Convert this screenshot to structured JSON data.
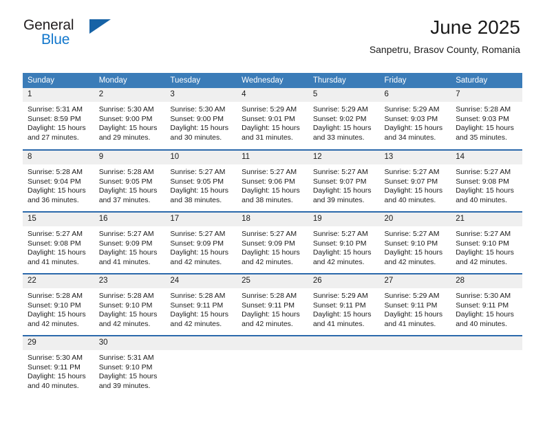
{
  "brand": {
    "name_part1": "General",
    "name_part2": "Blue",
    "triangle_icon": "triangle-icon",
    "colors": {
      "dark": "#231f20",
      "blue": "#1277cc",
      "triangle": "#1763a6"
    }
  },
  "header": {
    "title": "June 2025",
    "location": "Sanpetru, Brasov County, Romania"
  },
  "calendar": {
    "accent_color": "#3b7cb8",
    "row_divider_color": "#2a68ab",
    "daynum_band_color": "#efefef",
    "weekday_headers": [
      "Sunday",
      "Monday",
      "Tuesday",
      "Wednesday",
      "Thursday",
      "Friday",
      "Saturday"
    ],
    "weeks": [
      [
        {
          "day": "1",
          "sunrise": "Sunrise: 5:31 AM",
          "sunset": "Sunset: 8:59 PM",
          "daylight1": "Daylight: 15 hours",
          "daylight2": "and 27 minutes."
        },
        {
          "day": "2",
          "sunrise": "Sunrise: 5:30 AM",
          "sunset": "Sunset: 9:00 PM",
          "daylight1": "Daylight: 15 hours",
          "daylight2": "and 29 minutes."
        },
        {
          "day": "3",
          "sunrise": "Sunrise: 5:30 AM",
          "sunset": "Sunset: 9:00 PM",
          "daylight1": "Daylight: 15 hours",
          "daylight2": "and 30 minutes."
        },
        {
          "day": "4",
          "sunrise": "Sunrise: 5:29 AM",
          "sunset": "Sunset: 9:01 PM",
          "daylight1": "Daylight: 15 hours",
          "daylight2": "and 31 minutes."
        },
        {
          "day": "5",
          "sunrise": "Sunrise: 5:29 AM",
          "sunset": "Sunset: 9:02 PM",
          "daylight1": "Daylight: 15 hours",
          "daylight2": "and 33 minutes."
        },
        {
          "day": "6",
          "sunrise": "Sunrise: 5:29 AM",
          "sunset": "Sunset: 9:03 PM",
          "daylight1": "Daylight: 15 hours",
          "daylight2": "and 34 minutes."
        },
        {
          "day": "7",
          "sunrise": "Sunrise: 5:28 AM",
          "sunset": "Sunset: 9:03 PM",
          "daylight1": "Daylight: 15 hours",
          "daylight2": "and 35 minutes."
        }
      ],
      [
        {
          "day": "8",
          "sunrise": "Sunrise: 5:28 AM",
          "sunset": "Sunset: 9:04 PM",
          "daylight1": "Daylight: 15 hours",
          "daylight2": "and 36 minutes."
        },
        {
          "day": "9",
          "sunrise": "Sunrise: 5:28 AM",
          "sunset": "Sunset: 9:05 PM",
          "daylight1": "Daylight: 15 hours",
          "daylight2": "and 37 minutes."
        },
        {
          "day": "10",
          "sunrise": "Sunrise: 5:27 AM",
          "sunset": "Sunset: 9:05 PM",
          "daylight1": "Daylight: 15 hours",
          "daylight2": "and 38 minutes."
        },
        {
          "day": "11",
          "sunrise": "Sunrise: 5:27 AM",
          "sunset": "Sunset: 9:06 PM",
          "daylight1": "Daylight: 15 hours",
          "daylight2": "and 38 minutes."
        },
        {
          "day": "12",
          "sunrise": "Sunrise: 5:27 AM",
          "sunset": "Sunset: 9:07 PM",
          "daylight1": "Daylight: 15 hours",
          "daylight2": "and 39 minutes."
        },
        {
          "day": "13",
          "sunrise": "Sunrise: 5:27 AM",
          "sunset": "Sunset: 9:07 PM",
          "daylight1": "Daylight: 15 hours",
          "daylight2": "and 40 minutes."
        },
        {
          "day": "14",
          "sunrise": "Sunrise: 5:27 AM",
          "sunset": "Sunset: 9:08 PM",
          "daylight1": "Daylight: 15 hours",
          "daylight2": "and 40 minutes."
        }
      ],
      [
        {
          "day": "15",
          "sunrise": "Sunrise: 5:27 AM",
          "sunset": "Sunset: 9:08 PM",
          "daylight1": "Daylight: 15 hours",
          "daylight2": "and 41 minutes."
        },
        {
          "day": "16",
          "sunrise": "Sunrise: 5:27 AM",
          "sunset": "Sunset: 9:09 PM",
          "daylight1": "Daylight: 15 hours",
          "daylight2": "and 41 minutes."
        },
        {
          "day": "17",
          "sunrise": "Sunrise: 5:27 AM",
          "sunset": "Sunset: 9:09 PM",
          "daylight1": "Daylight: 15 hours",
          "daylight2": "and 42 minutes."
        },
        {
          "day": "18",
          "sunrise": "Sunrise: 5:27 AM",
          "sunset": "Sunset: 9:09 PM",
          "daylight1": "Daylight: 15 hours",
          "daylight2": "and 42 minutes."
        },
        {
          "day": "19",
          "sunrise": "Sunrise: 5:27 AM",
          "sunset": "Sunset: 9:10 PM",
          "daylight1": "Daylight: 15 hours",
          "daylight2": "and 42 minutes."
        },
        {
          "day": "20",
          "sunrise": "Sunrise: 5:27 AM",
          "sunset": "Sunset: 9:10 PM",
          "daylight1": "Daylight: 15 hours",
          "daylight2": "and 42 minutes."
        },
        {
          "day": "21",
          "sunrise": "Sunrise: 5:27 AM",
          "sunset": "Sunset: 9:10 PM",
          "daylight1": "Daylight: 15 hours",
          "daylight2": "and 42 minutes."
        }
      ],
      [
        {
          "day": "22",
          "sunrise": "Sunrise: 5:28 AM",
          "sunset": "Sunset: 9:10 PM",
          "daylight1": "Daylight: 15 hours",
          "daylight2": "and 42 minutes."
        },
        {
          "day": "23",
          "sunrise": "Sunrise: 5:28 AM",
          "sunset": "Sunset: 9:10 PM",
          "daylight1": "Daylight: 15 hours",
          "daylight2": "and 42 minutes."
        },
        {
          "day": "24",
          "sunrise": "Sunrise: 5:28 AM",
          "sunset": "Sunset: 9:11 PM",
          "daylight1": "Daylight: 15 hours",
          "daylight2": "and 42 minutes."
        },
        {
          "day": "25",
          "sunrise": "Sunrise: 5:28 AM",
          "sunset": "Sunset: 9:11 PM",
          "daylight1": "Daylight: 15 hours",
          "daylight2": "and 42 minutes."
        },
        {
          "day": "26",
          "sunrise": "Sunrise: 5:29 AM",
          "sunset": "Sunset: 9:11 PM",
          "daylight1": "Daylight: 15 hours",
          "daylight2": "and 41 minutes."
        },
        {
          "day": "27",
          "sunrise": "Sunrise: 5:29 AM",
          "sunset": "Sunset: 9:11 PM",
          "daylight1": "Daylight: 15 hours",
          "daylight2": "and 41 minutes."
        },
        {
          "day": "28",
          "sunrise": "Sunrise: 5:30 AM",
          "sunset": "Sunset: 9:11 PM",
          "daylight1": "Daylight: 15 hours",
          "daylight2": "and 40 minutes."
        }
      ],
      [
        {
          "day": "29",
          "sunrise": "Sunrise: 5:30 AM",
          "sunset": "Sunset: 9:11 PM",
          "daylight1": "Daylight: 15 hours",
          "daylight2": "and 40 minutes."
        },
        {
          "day": "30",
          "sunrise": "Sunrise: 5:31 AM",
          "sunset": "Sunset: 9:10 PM",
          "daylight1": "Daylight: 15 hours",
          "daylight2": "and 39 minutes."
        },
        {
          "day": "",
          "sunrise": "",
          "sunset": "",
          "daylight1": "",
          "daylight2": ""
        },
        {
          "day": "",
          "sunrise": "",
          "sunset": "",
          "daylight1": "",
          "daylight2": ""
        },
        {
          "day": "",
          "sunrise": "",
          "sunset": "",
          "daylight1": "",
          "daylight2": ""
        },
        {
          "day": "",
          "sunrise": "",
          "sunset": "",
          "daylight1": "",
          "daylight2": ""
        },
        {
          "day": "",
          "sunrise": "",
          "sunset": "",
          "daylight1": "",
          "daylight2": ""
        }
      ]
    ]
  }
}
